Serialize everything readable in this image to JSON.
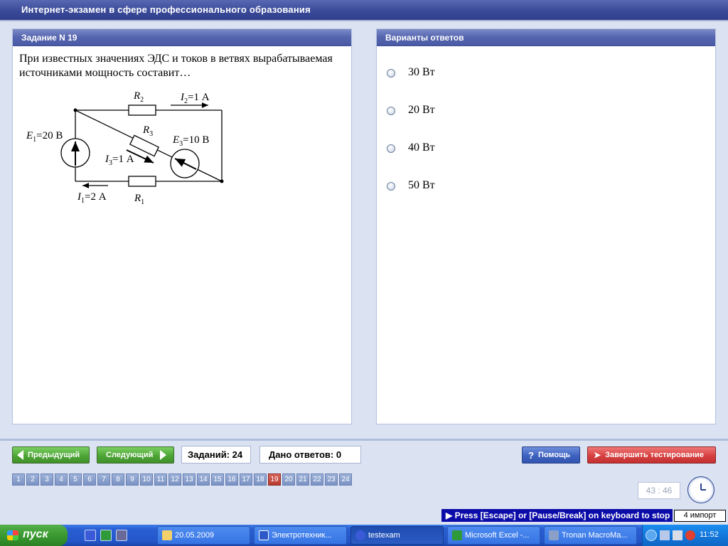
{
  "window": {
    "title": "Интернет-экзамен в сфере профессионального образования"
  },
  "task": {
    "header": "Задание N 19",
    "question": "При известных значениях ЭДС и токов в ветвях вырабатываемая источниками мощность составит…",
    "circuit_labels": {
      "r2": "R",
      "r2_sub": "2",
      "i2": "I",
      "i2_sub": "2",
      "i2_val": "=1 А",
      "r3": "R",
      "r3_sub": "3",
      "e1": "E",
      "e1_sub": "1",
      "e1_val": "=20 В",
      "e3": "E",
      "e3_sub": "3",
      "e3_val": "=10 В",
      "i3": "I",
      "i3_sub": "3",
      "i3_val": "=1 А",
      "i1": "I",
      "i1_sub": "1",
      "i1_val": "=2 А",
      "r1": "R",
      "r1_sub": "1"
    }
  },
  "answers": {
    "header": "Варианты ответов",
    "options": [
      {
        "label": "30 Вт"
      },
      {
        "label": "20 Вт"
      },
      {
        "label": "40 Вт"
      },
      {
        "label": "50 Вт"
      }
    ]
  },
  "controls": {
    "prev_label": "Предыдущий",
    "next_label": "Следующий",
    "tasks_count": "Заданий: 24",
    "answers_given": "Дано ответов: 0",
    "help_label": "Помощь",
    "finish_label": "Завершить тестирование",
    "pages": [
      "1",
      "2",
      "3",
      "4",
      "5",
      "6",
      "7",
      "8",
      "9",
      "10",
      "11",
      "12",
      "13",
      "14",
      "15",
      "16",
      "17",
      "18",
      "19",
      "20",
      "21",
      "22",
      "23",
      "24"
    ],
    "current_page": "19",
    "timer": "43 : 46"
  },
  "banner": {
    "text": "Press [Escape] or [Pause/Break] on keyboard to stop",
    "extra": "4 импорт"
  },
  "taskbar": {
    "start_label": "пуск",
    "windows": [
      {
        "label": "20.05.2009"
      },
      {
        "label": "Электротехник..."
      },
      {
        "label": "testexam"
      },
      {
        "label": "Microsoft Excel -..."
      },
      {
        "label": "Tronan MacroMa..."
      }
    ],
    "time": "11:52"
  },
  "colors": {
    "accent": "#4a5aa4",
    "active_page": "#b83a30",
    "button_green": "#4ea536",
    "button_blue": "#3e62c0",
    "button_red": "#d64040"
  }
}
